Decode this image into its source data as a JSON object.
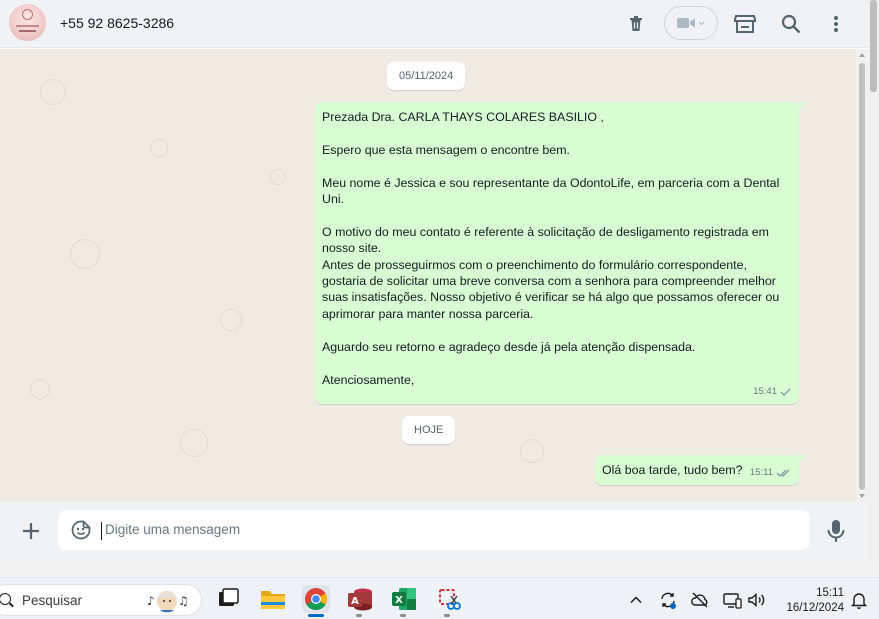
{
  "header": {
    "contact_name": "+55 92 8625-3286"
  },
  "chat": {
    "date_chips": [
      "05/11/2024",
      "HOJE"
    ],
    "messages": [
      {
        "direction": "outgoing",
        "text": "Prezada Dra. CARLA THAYS COLARES BASILIO ,\n\nEspero que esta mensagem o encontre bem.\n\nMeu nome é Jessica e sou representante da OdontoLife, em parceria com a Dental Uni.\n\nO motivo do meu contato é referente à solicitação de desligamento registrada em nosso site.\nAntes de prosseguirmos com o preenchimento do formulário correspondente, gostaria de solicitar uma breve conversa com a senhora para compreender melhor suas insatisfações. Nosso objetivo é verificar se há algo que possamos oferecer ou aprimorar para manter nossa parceria.\n\nAguardo seu retorno e agradeço desde já pela atenção dispensada.\n\nAtenciosamente,",
        "time": "15:41",
        "status": "delivered-single-check"
      },
      {
        "direction": "outgoing",
        "text": "Olá boa tarde, tudo bem?",
        "time": "15:11",
        "status": "delivered-double-check"
      }
    ]
  },
  "composer": {
    "placeholder": "Digite uma mensagem"
  },
  "taskbar": {
    "search_label": "Pesquisar",
    "apps": [
      "task-view-icon",
      "file-explorer-icon",
      "chrome-icon",
      "access-icon",
      "excel-icon",
      "snipping-tool-icon"
    ],
    "tray": [
      "chevron-up-icon",
      "sync-icon",
      "onedrive-offline-icon",
      "connection-icon",
      "speaker-icon"
    ],
    "time": "15:11",
    "date": "16/12/2024"
  },
  "colors": {
    "header_bg": "#f0f2f5",
    "chat_bg": "#efeae2",
    "outgoing_bubble": "#d9fdd3",
    "read_check": "#8696a0"
  }
}
